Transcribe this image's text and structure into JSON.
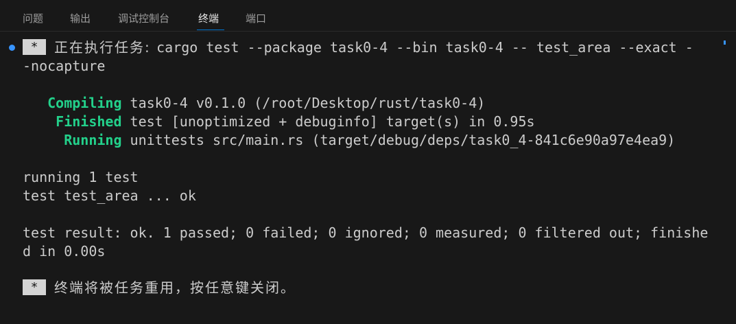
{
  "tabs": [
    {
      "label": "问题"
    },
    {
      "label": "输出"
    },
    {
      "label": "调试控制台"
    },
    {
      "label": "终端"
    },
    {
      "label": "端口"
    }
  ],
  "active_tab": "终端",
  "terminal": {
    "task_marker": "*",
    "command_line1_prefix": "正在执行任务: ",
    "command_line1_cmd": "cargo test --package task0-4 --bin task0-4 -- test_area --exact -",
    "command_line2": "-nocapture",
    "compiling_label": "Compiling",
    "compiling_text": " task0-4 v0.1.0 (/root/Desktop/rust/task0-4)",
    "finished_label": "Finished",
    "finished_text": " test [unoptimized + debuginfo] target(s) in 0.95s",
    "running_label": "Running",
    "running_text": " unittests src/main.rs (target/debug/deps/task0_4-841c6e90a97e4ea9)",
    "running_tests": "running 1 test",
    "test_line": "test test_area ... ok",
    "result_line1": "test result: ok. 1 passed; 0 failed; 0 ignored; 0 measured; 0 filtered out; finishe",
    "result_line2": "d in 0.00s",
    "reuse_message": "终端将被任务重用，按任意键关闭。"
  },
  "colors": {
    "background": "#181818",
    "text": "#cccccc",
    "green": "#23d18b",
    "accent": "#0078d4",
    "dot": "#3794ff"
  },
  "icons": {
    "command_decoration": "circle-dot-icon"
  }
}
